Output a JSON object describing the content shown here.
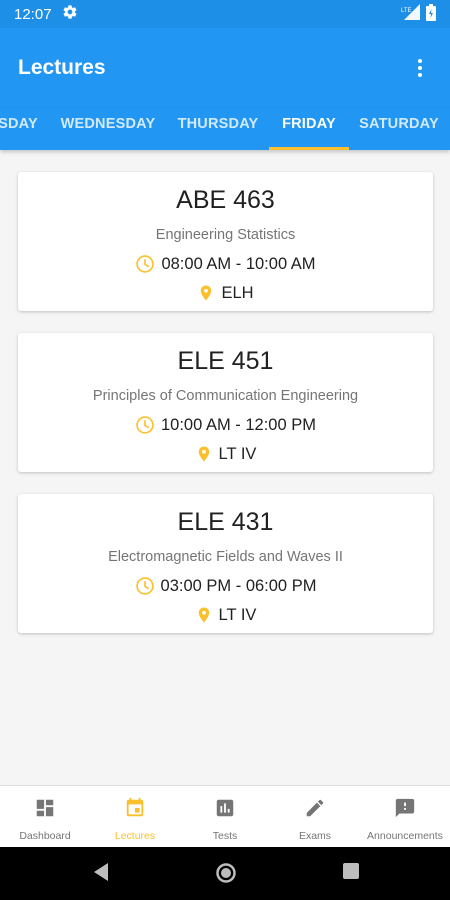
{
  "status_bar": {
    "time": "12:07",
    "lte_label": "LTE"
  },
  "app_bar": {
    "title": "Lectures"
  },
  "tabs": [
    {
      "label": "SDAY"
    },
    {
      "label": "WEDNESDAY"
    },
    {
      "label": "THURSDAY"
    },
    {
      "label": "FRIDAY",
      "active": true
    },
    {
      "label": "SATURDAY"
    }
  ],
  "lectures": [
    {
      "code": "ABE 463",
      "title": "Engineering Statistics",
      "time": "08:00 AM - 10:00 AM",
      "venue": "ELH"
    },
    {
      "code": "ELE 451",
      "title": "Principles of Communication Engineering",
      "time": "10:00 AM - 12:00 PM",
      "venue": "LT IV"
    },
    {
      "code": "ELE 431",
      "title": "Electromagnetic Fields and Waves II",
      "time": "03:00 PM - 06:00 PM",
      "venue": "LT IV"
    }
  ],
  "bottom_nav": [
    {
      "label": "Dashboard",
      "icon": "dashboard-icon"
    },
    {
      "label": "Lectures",
      "icon": "calendar-icon",
      "active": true
    },
    {
      "label": "Tests",
      "icon": "bar-chart-icon"
    },
    {
      "label": "Exams",
      "icon": "pencil-icon"
    },
    {
      "label": "Announcements",
      "icon": "feedback-icon"
    }
  ],
  "colors": {
    "primary": "#2196f3",
    "status_bar": "#1e8fe6",
    "accent": "#fbc02d"
  }
}
